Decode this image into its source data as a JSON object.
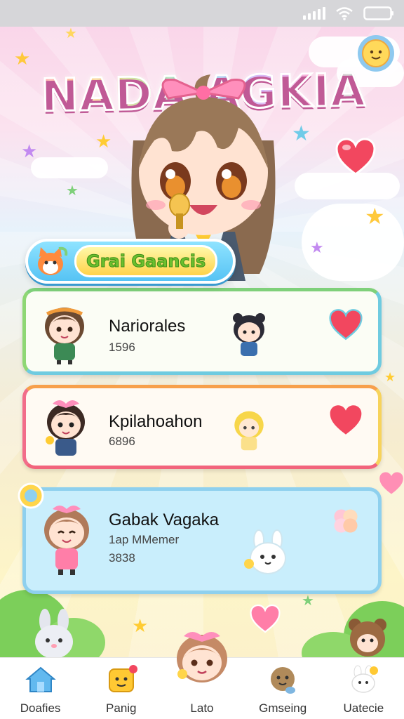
{
  "app": {
    "title": "NADA AGKIA"
  },
  "section": {
    "title": "Grai Gaancis"
  },
  "cards": [
    {
      "name": "Nariorales",
      "count": "1596"
    },
    {
      "name": "Kpilahoahon",
      "count": "6896"
    },
    {
      "name": "Gabak Vagaka",
      "meta": "1ap MMemer",
      "count": "3838"
    }
  ],
  "nav": [
    {
      "label": "Doafies",
      "icon": "home-icon"
    },
    {
      "label": "Panig",
      "icon": "smiley-box-icon",
      "badge": true
    },
    {
      "label": "Lato",
      "icon": "mascot-icon"
    },
    {
      "label": "Gmseing",
      "icon": "bear-icon"
    },
    {
      "label": "Uatecie",
      "icon": "bunny-icon",
      "badge": true
    }
  ],
  "colors": {
    "accent": "#ff7eb8",
    "banner": "#56c3f4",
    "heart": "#f2475f",
    "status_bar": "#d6d6d9"
  }
}
